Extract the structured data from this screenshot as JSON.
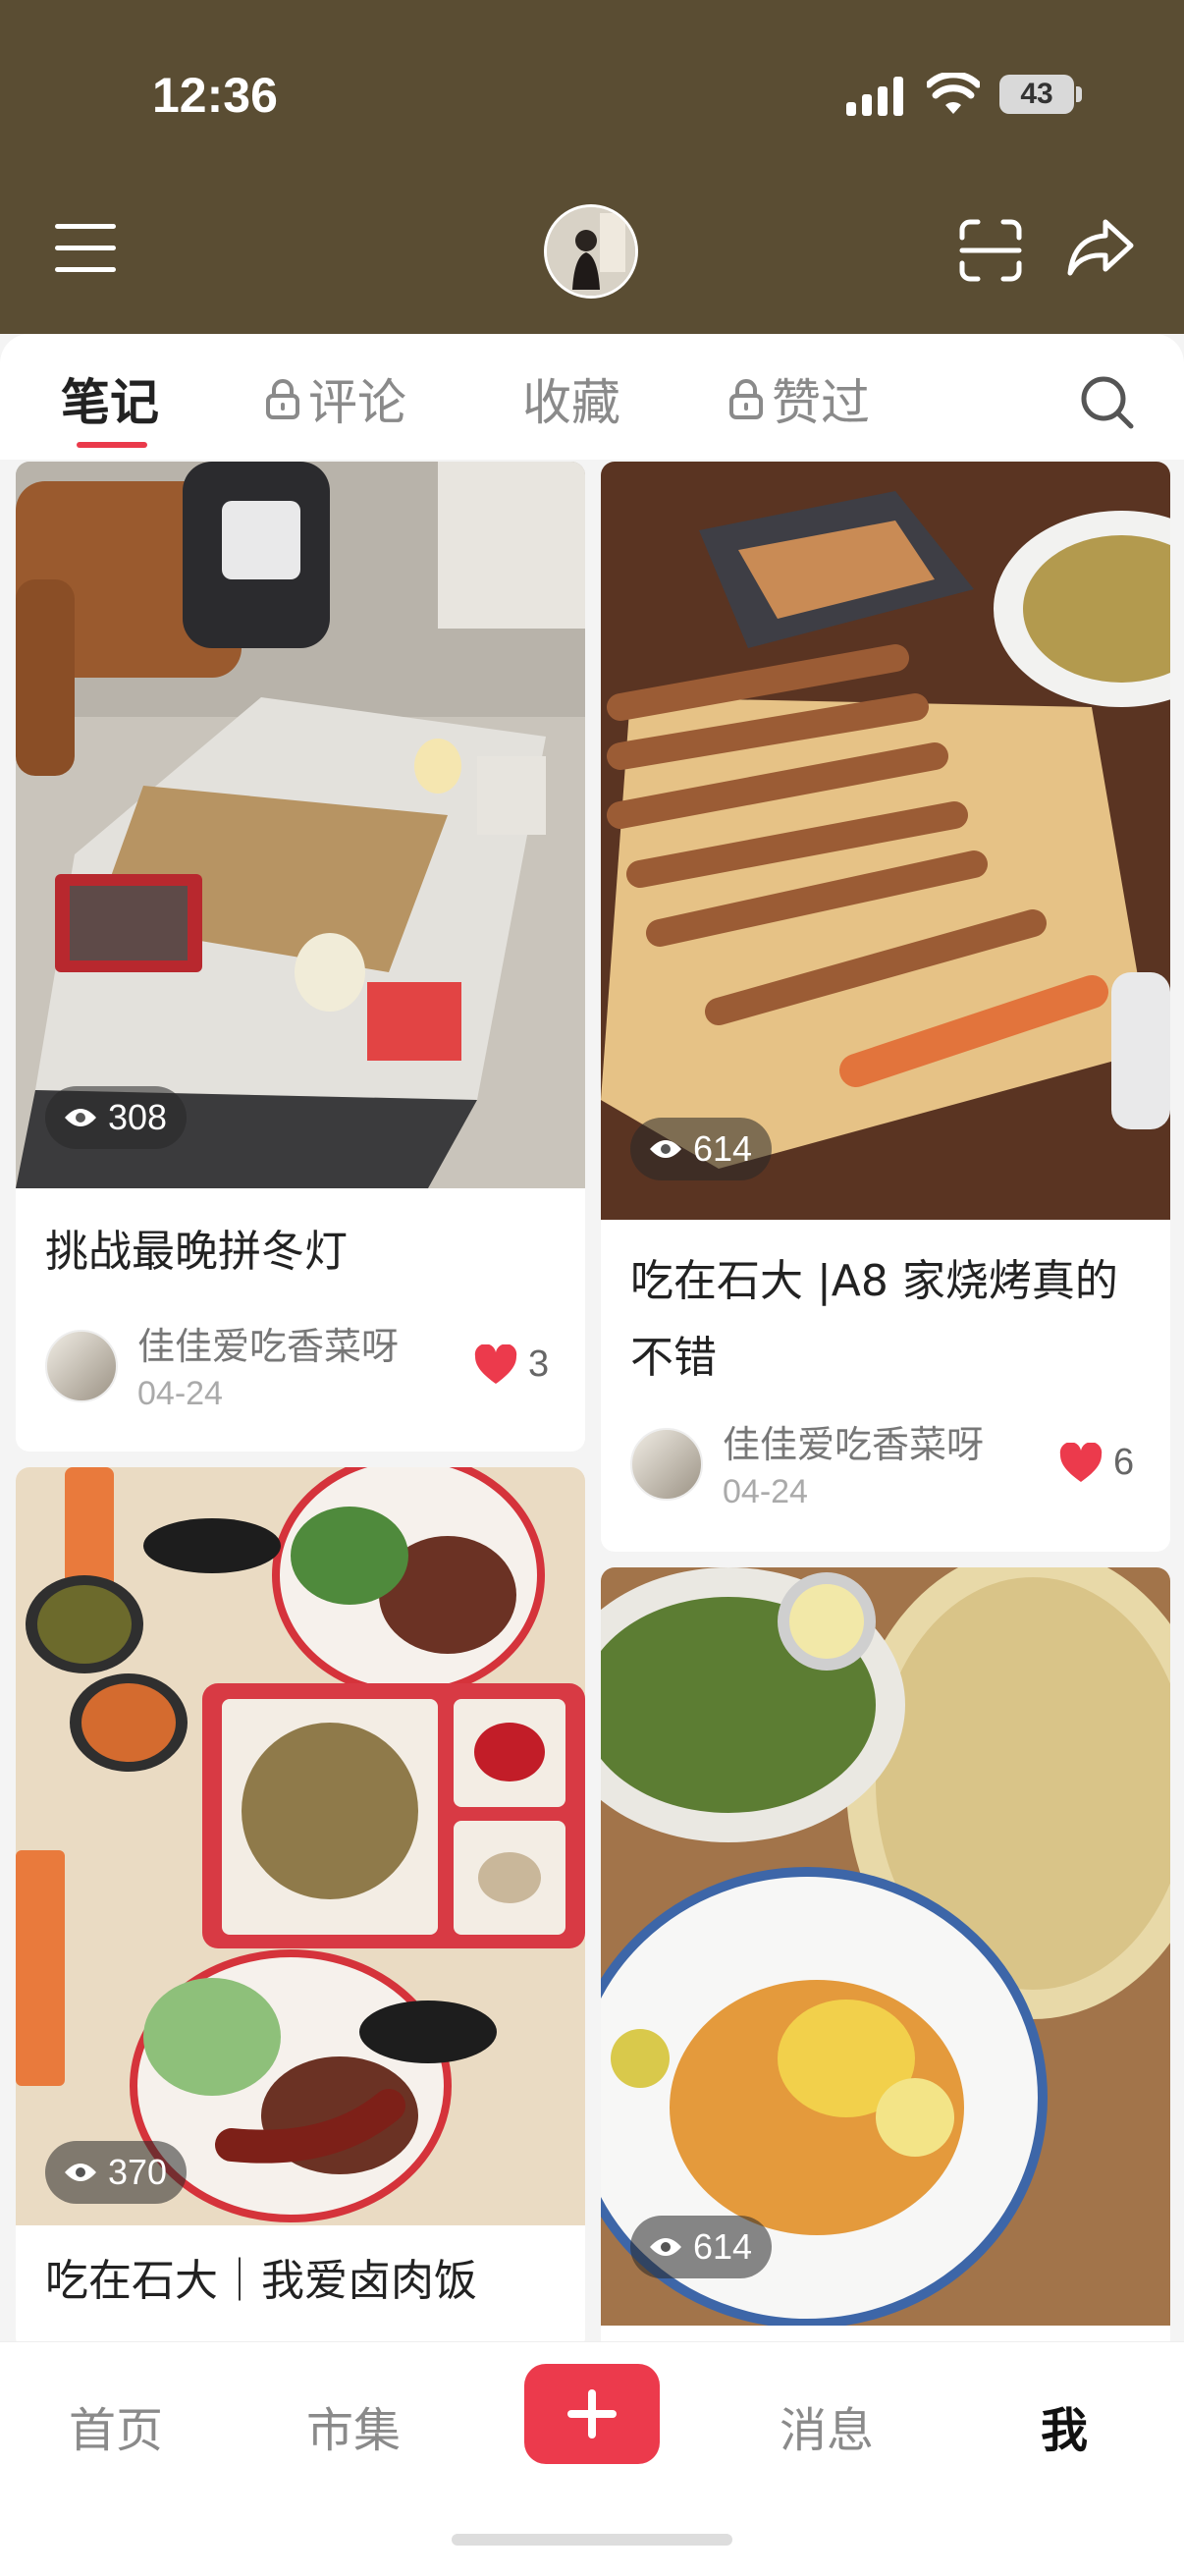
{
  "status": {
    "time": "12:36",
    "battery": "43"
  },
  "tabs": [
    {
      "label": "笔记",
      "locked": false
    },
    {
      "label": "评论",
      "locked": true
    },
    {
      "label": "收藏",
      "locked": false
    },
    {
      "label": "赞过",
      "locked": true
    }
  ],
  "notes": [
    {
      "title": "挑战最晚拼冬灯",
      "views": "308",
      "author": "佳佳爱吃香菜呀",
      "date": "04-24",
      "likes": "3",
      "scene": "living room coffee table with jigsaw puzzle"
    },
    {
      "title": "吃在石大 |A8 家烧烤真的不错",
      "title_line1": "吃在石大 |A8 家烧烤真的",
      "title_line2": "不错",
      "views": "614",
      "author": "佳佳爱吃香菜呀",
      "date": "04-24",
      "likes": "6",
      "scene": "grilled skewers on a board"
    },
    {
      "title": "吃在石大｜我爱卤肉饭",
      "views": "370",
      "scene": "braised pork rice bowls and tray"
    },
    {
      "views": "614",
      "scene": "salad, pizza and plated dish"
    }
  ],
  "nav": {
    "home": "首页",
    "market": "市集",
    "messages": "消息",
    "me": "我"
  },
  "colors": {
    "header_bg": "#5a4d33",
    "accent": "#ec3a4c"
  }
}
